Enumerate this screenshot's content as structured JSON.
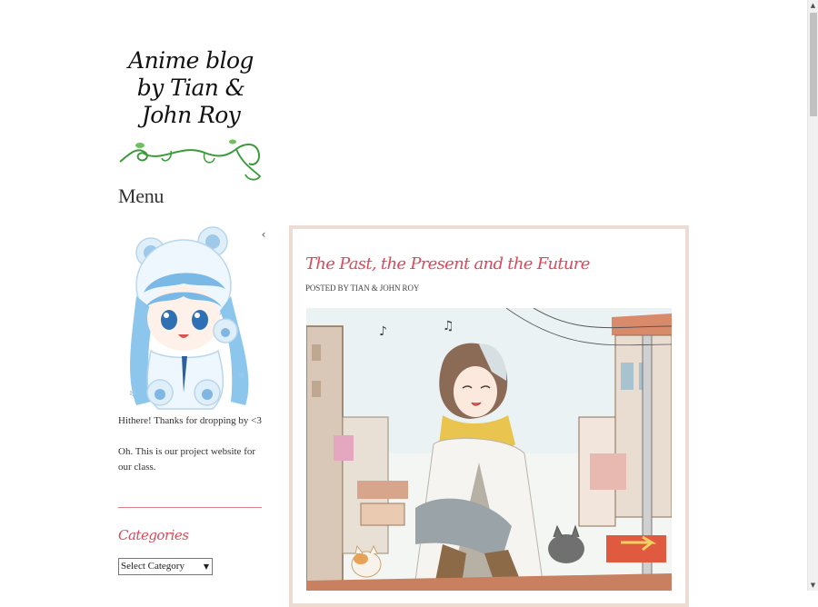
{
  "site": {
    "title": "Anime blog by Tian & John Roy"
  },
  "sidebar": {
    "menu_heading": "Menu",
    "menu_toggle_glyph": "‹",
    "greeting": "Hithere! Thanks for dropping by <3",
    "about": "Oh. This is our project website for our class.",
    "categories_heading": "Categories",
    "category_select": {
      "selected": "Select Category"
    }
  },
  "post": {
    "title": "The Past, the Present and the Future",
    "meta": "POSTED BY TIAN & JOHN ROY"
  },
  "colors": {
    "accent": "#d94a5a",
    "card_border": "#ecdcd4",
    "swirl": "#3a9a3a"
  },
  "icons": {
    "menu_toggle": "chevron-left-icon",
    "scroll_up": "arrow-up-icon",
    "scroll_down": "arrow-down-icon",
    "select_caret": "caret-down-icon"
  }
}
